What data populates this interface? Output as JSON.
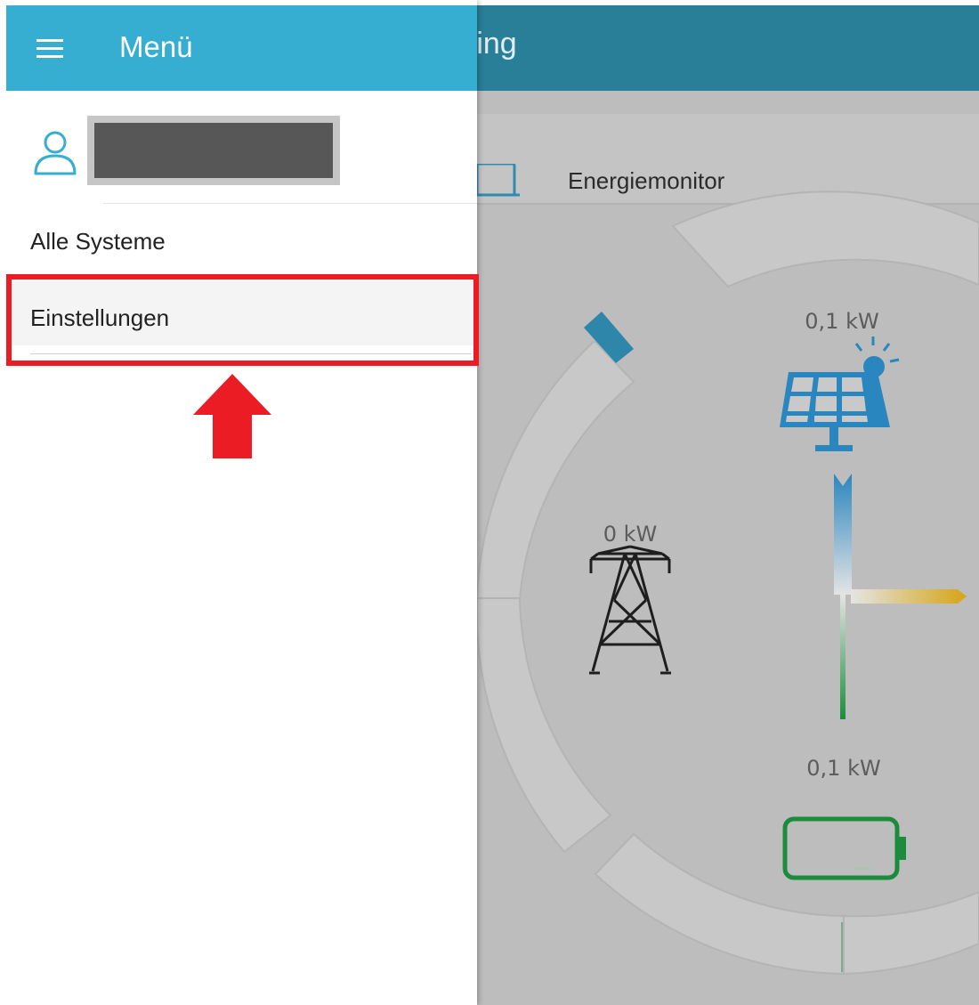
{
  "app": {
    "title_partial": "ring"
  },
  "drawer": {
    "title": "Menü",
    "user": {
      "name": "████████"
    },
    "items": [
      {
        "label": "Alle Systeme"
      },
      {
        "label": "Einstellungen",
        "highlighted": true
      }
    ]
  },
  "tab": {
    "label": "Energiemonitor"
  },
  "energy": {
    "solar_value": "0,1 kW",
    "grid_value": "0 kW",
    "battery_value": "0,1 kW"
  },
  "colors": {
    "drawer_header": "#35aed2",
    "app_header": "#2a7f98",
    "highlight": "#ec1c24",
    "solar": "#2a86bf",
    "battery": "#1c8c3c",
    "consumption": "#d5a414"
  },
  "icons": {
    "menu": "hamburger-icon",
    "user": "user-icon",
    "arrow": "arrow-up-icon",
    "solar": "solar-panel-icon",
    "grid": "power-tower-icon",
    "battery": "battery-icon",
    "monitor": "laptop-icon"
  }
}
